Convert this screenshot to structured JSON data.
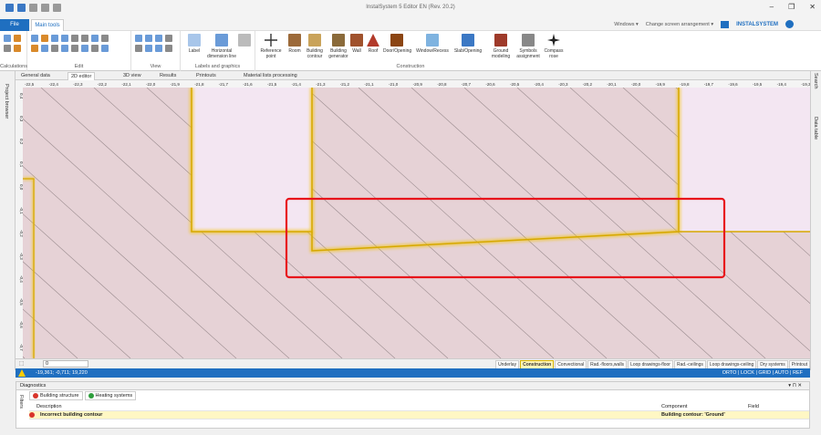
{
  "app": {
    "title": "InstalSystem 5 Editor EN (Rev. 20.2)",
    "min": "–",
    "max": "❐",
    "close": "✕"
  },
  "menu": {
    "file": "File",
    "main_tools": "Main tools",
    "windows": "Windows ▾",
    "change_arrangement": "Change screen arrangement ▾",
    "logo": "INSTALSYSTEM"
  },
  "ribbon": {
    "groups": {
      "calculations": "Calculations",
      "edit": "Edit",
      "view": "View",
      "labels": "Labels and graphics",
      "construction": "Construction"
    },
    "buttons": {
      "label": "Label",
      "horizontal_dimension": "Horizontal dimension line",
      "reference_point": "Reference point",
      "room": "Room",
      "building_contour": "Building contour",
      "building_generator": "Building generator",
      "wall": "Wall",
      "roof": "Roof",
      "door_opening": "Door/Opening",
      "window_recess": "Window/Recess",
      "slab_opening": "Slab/Opening",
      "ground_modeling": "Ground modeling",
      "symbols_assignment": "Symbols assignment",
      "compass_rose": "Compass rose"
    }
  },
  "doc_tabs": {
    "general_data": "General data",
    "editor_2d": "2D editor",
    "view_3d": "3D view",
    "results": "Results",
    "printouts": "Printouts",
    "material_lists": "Material lists processing"
  },
  "side": {
    "project_browser": "Project browser",
    "search": "Search",
    "data_table": "Data table"
  },
  "ruler": {
    "x_ticks": [
      "-22,5",
      "-22,4",
      "-22,3",
      "-22,2",
      "-22,1",
      "-22,0",
      "-21,9",
      "-21,8",
      "-21,7",
      "-21,6",
      "-21,5",
      "-21,4",
      "-21,3",
      "-21,2",
      "-21,1",
      "-21,0",
      "-20,9",
      "-20,8",
      "-20,7",
      "-20,6",
      "-20,5",
      "-20,4",
      "-20,3",
      "-20,2",
      "-20,1",
      "-20,0",
      "-19,9",
      "-19,8",
      "-19,7",
      "-19,6",
      "-19,5",
      "-19,4",
      "-19,3",
      "-19,2"
    ],
    "y_ticks": [
      "0,4",
      "0,3",
      "0,2",
      "0,1",
      "0,0",
      "-0,1",
      "-0,2",
      "-0,3",
      "-0,4",
      "-0,5",
      "-0,6",
      "-0,7"
    ]
  },
  "statusbar": {
    "level": "0",
    "layers": [
      "Underlay",
      "Construction",
      "Convectional",
      "Rad.-floors,walls",
      "Loop drawings-floor",
      "Rad.-ceilings",
      "Loop drawings-ceiling",
      "Dry systems",
      "Printout"
    ],
    "active_layer": "Construction",
    "coords": "-19,361; -0,711; 19,220",
    "modes": "ORTO | LOCK | GRID | AUTO | REF"
  },
  "diagnostics": {
    "title": "Diagnostics",
    "filters": "Filters",
    "tabs": [
      "Building structure",
      "Heating systems"
    ],
    "columns": {
      "description": "Description",
      "component": "Component",
      "field": "Field"
    },
    "rows": [
      {
        "description": "Incorrect building contour",
        "component": "Building contour: 'Ground'",
        "field": ""
      }
    ]
  },
  "colors": {
    "accent": "#1f6fc0",
    "canvas_bg": "#e6d2d6",
    "room_fill": "#f3e6f2",
    "contour": "#f2c40e",
    "highlight": "#e8141b"
  }
}
